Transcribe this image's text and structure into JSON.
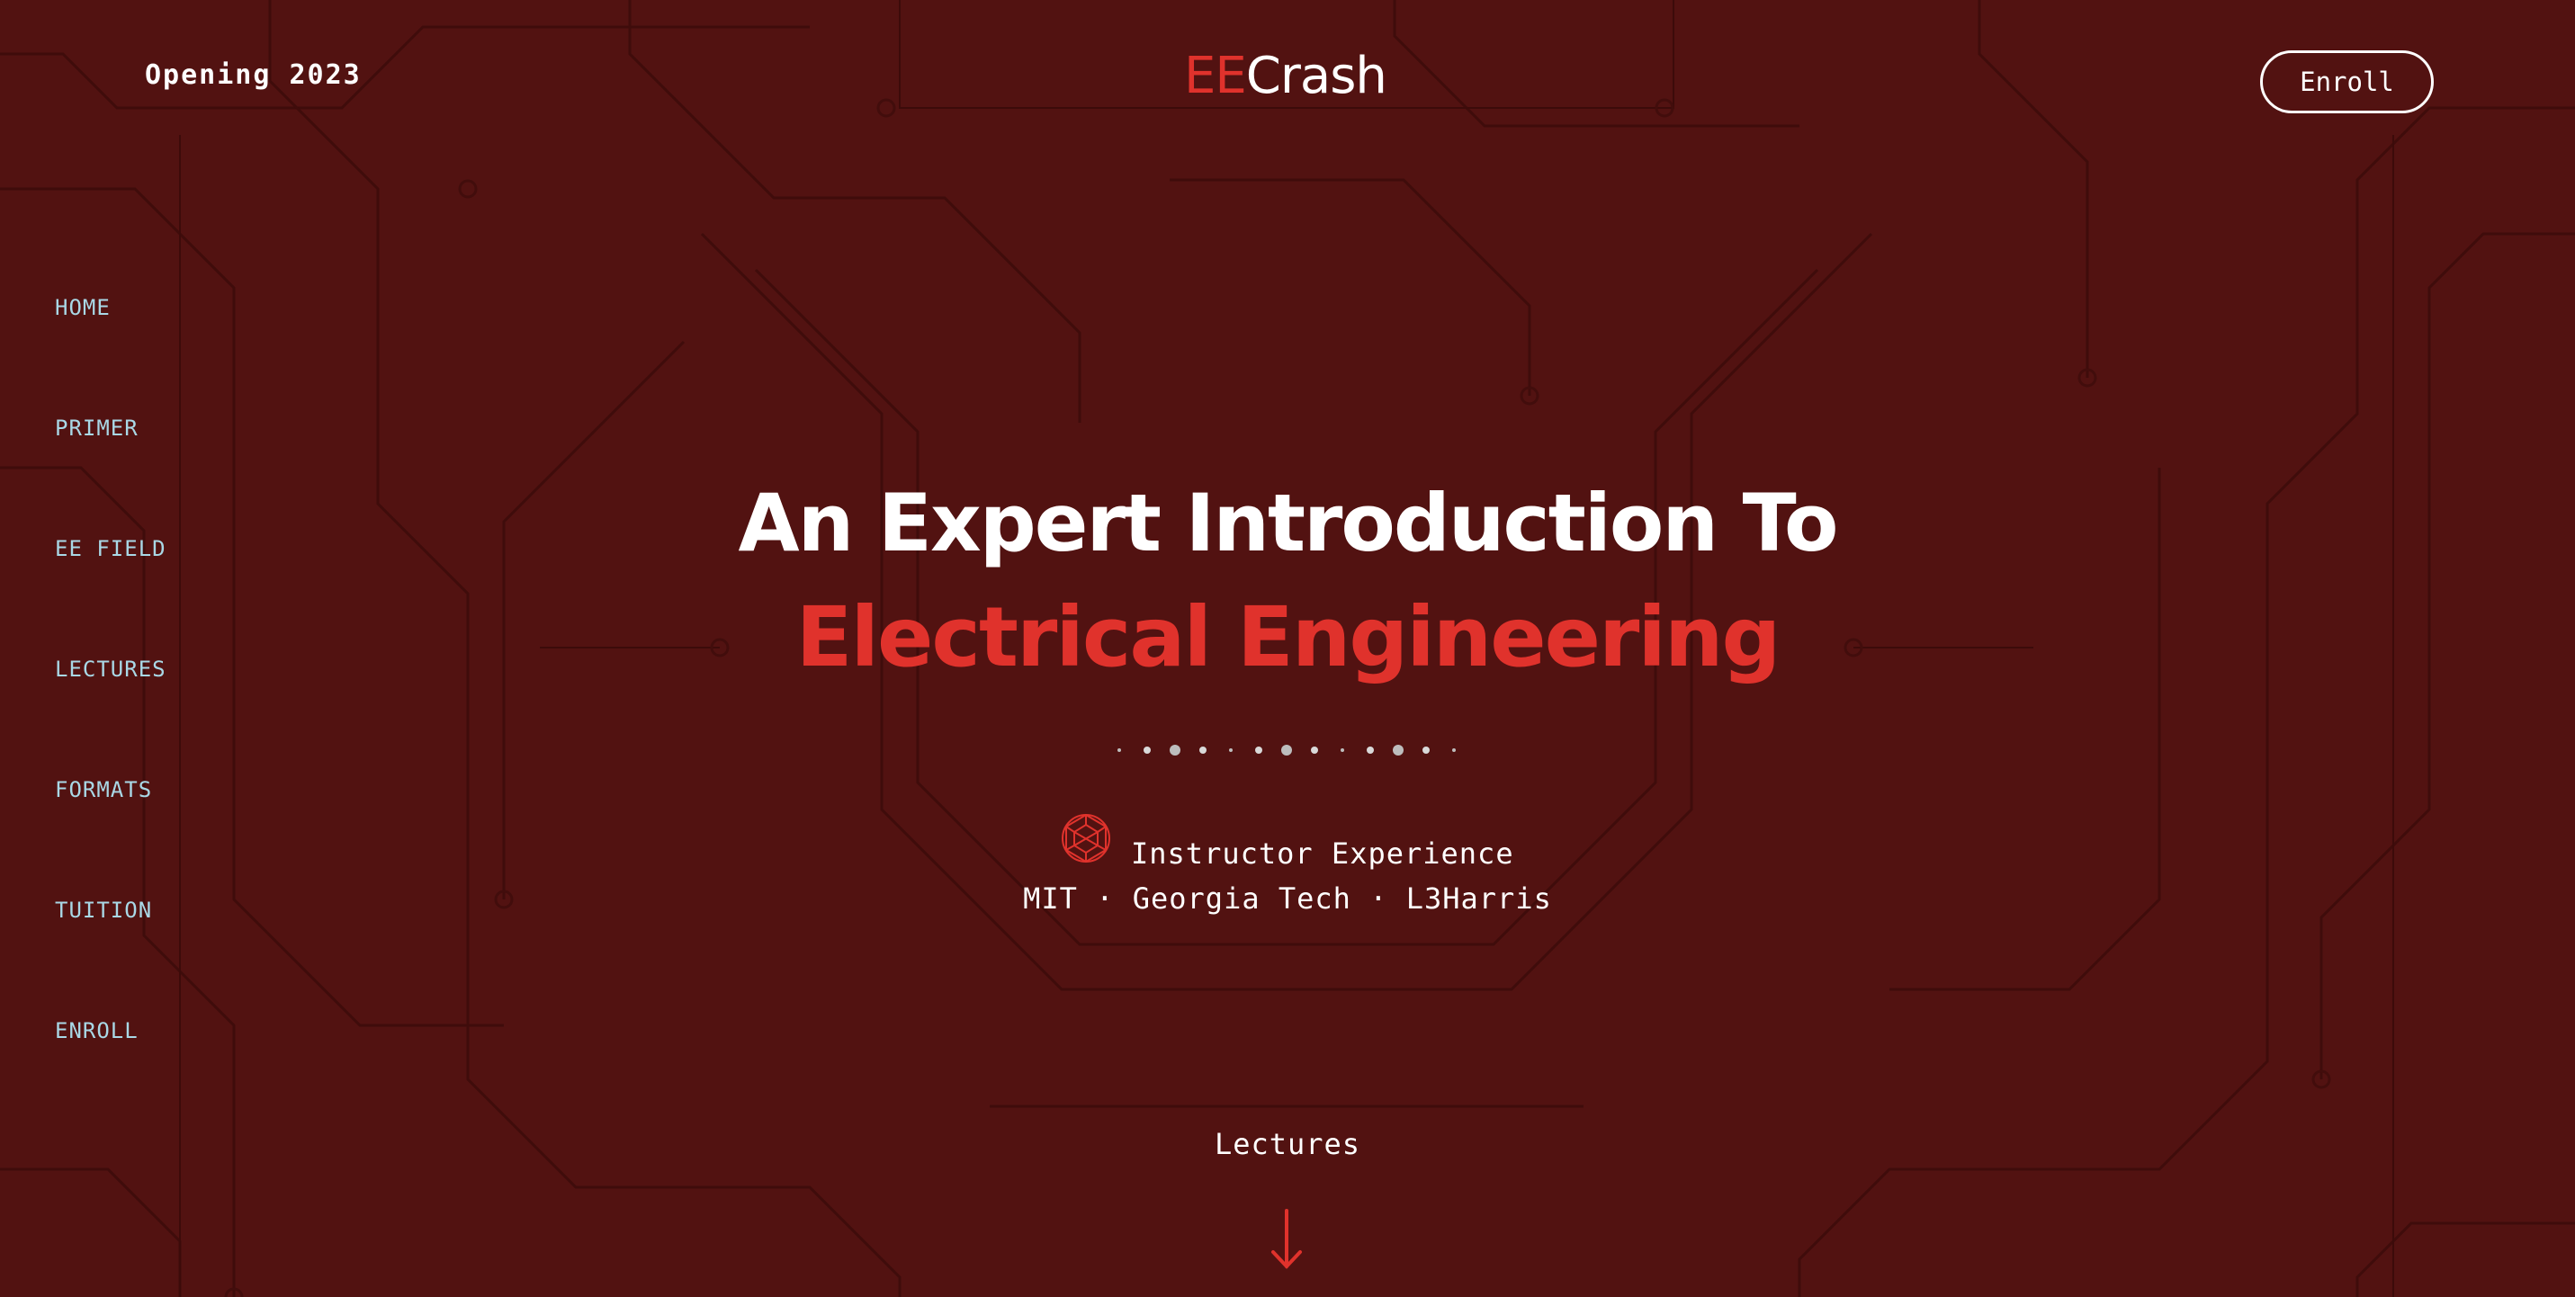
{
  "header": {
    "tagline": "Opening 2023",
    "logo": {
      "part1": "EE",
      "part2": "Crash"
    },
    "enroll_label": "Enroll"
  },
  "sidebar": {
    "items": [
      {
        "label": "HOME"
      },
      {
        "label": "PRIMER"
      },
      {
        "label": "EE FIELD"
      },
      {
        "label": "LECTURES"
      },
      {
        "label": "FORMATS"
      },
      {
        "label": "TUITION"
      },
      {
        "label": "ENROLL"
      }
    ]
  },
  "hero": {
    "title_line1": "An Expert Introduction To",
    "title_line2": "Electrical Engineering",
    "experience_title": "Instructor Experience",
    "experience_schools": "MIT · Georgia Tech · L3Harris",
    "scroll_label": "Lectures"
  },
  "icons": {
    "experience": "geodesic-sphere-icon",
    "scroll": "arrow-down-icon",
    "divider": "dots-divider"
  },
  "colors": {
    "background": "#521211",
    "accent": "#e0322c",
    "nav_text": "#a9d8e6",
    "text": "#ffffff"
  }
}
